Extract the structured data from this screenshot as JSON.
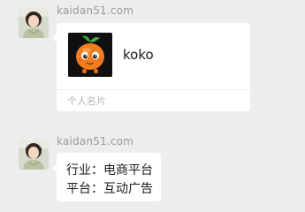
{
  "messages": [
    {
      "sender": "kaidan51.com",
      "type": "contact_card",
      "card": {
        "name": "koko",
        "label": "个人名片"
      }
    },
    {
      "sender": "kaidan51.com",
      "type": "text",
      "lines": [
        "行业：电商平台",
        "平台：互动广告"
      ]
    }
  ],
  "colors": {
    "background": "#ededed",
    "bubble": "#ffffff",
    "sender_text": "#9a9a9a",
    "card_label": "#b2b2b2",
    "mascot_orange": "#f07d1e",
    "mascot_leaf": "#3fa33a"
  },
  "icons": {
    "user_avatar": "girl-photo-avatar",
    "card_avatar": "orange-mascot-avatar"
  }
}
